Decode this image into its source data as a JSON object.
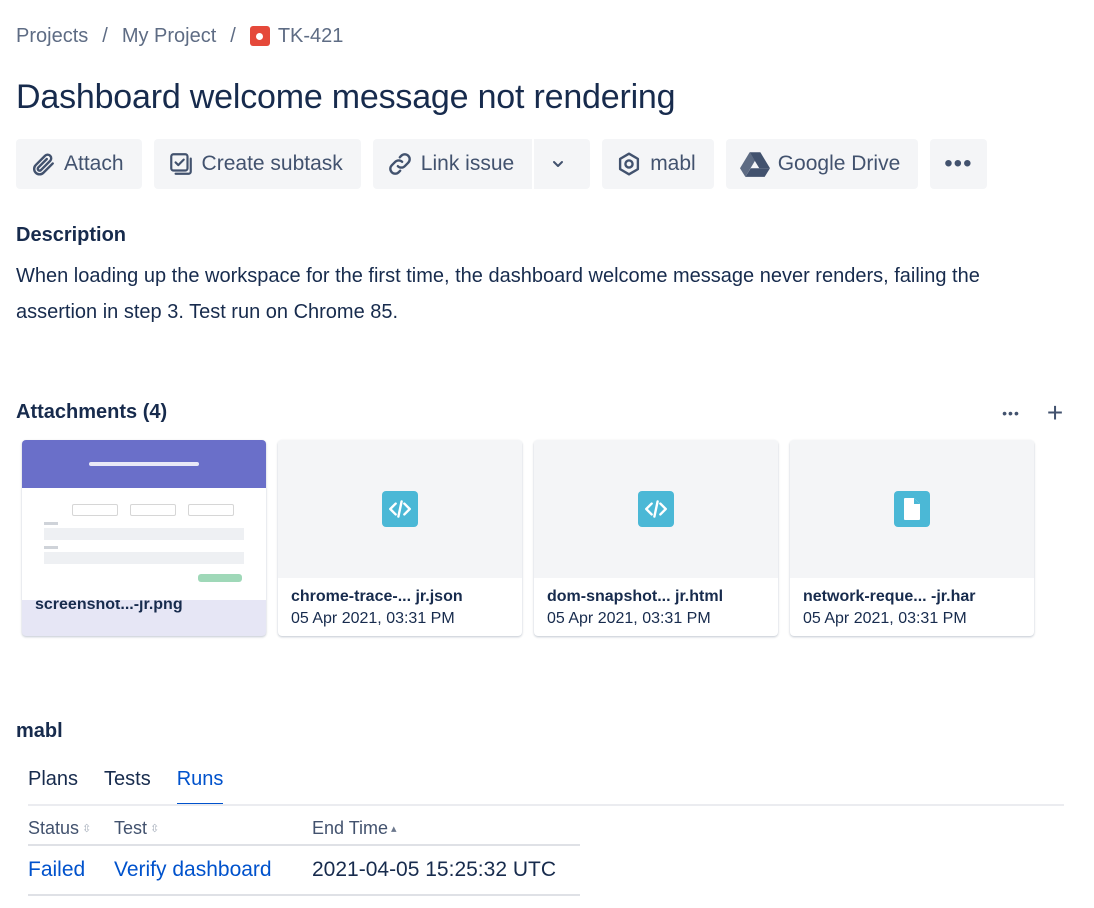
{
  "breadcrumb": {
    "projects": "Projects",
    "separator": "/",
    "project": "My Project",
    "issue_key": "TK-421"
  },
  "issue": {
    "title": "Dashboard welcome message not rendering"
  },
  "toolbar": {
    "attach": "Attach",
    "create_subtask": "Create subtask",
    "link_issue": "Link issue",
    "mabl": "mabl",
    "google_drive": "Google Drive",
    "more": "•••"
  },
  "description": {
    "heading": "Description",
    "text": "When loading up the workspace for the first time, the dashboard welcome message never renders, failing the assertion in step 3. Test run on Chrome 85."
  },
  "attachments": {
    "heading": "Attachments (4)",
    "more": "•••",
    "add": "+",
    "items": [
      {
        "name": "screenshot...-jr.png",
        "date": "",
        "kind": "image"
      },
      {
        "name": "chrome-trace-... jr.json",
        "date": "05 Apr 2021, 03:31 PM",
        "kind": "code"
      },
      {
        "name": "dom-snapshot... jr.html",
        "date": "05 Apr 2021, 03:31 PM",
        "kind": "code"
      },
      {
        "name": "network-reque... -jr.har",
        "date": "05 Apr 2021, 03:31 PM",
        "kind": "document"
      }
    ]
  },
  "mabl": {
    "heading": "mabl",
    "tabs": [
      {
        "label": "Plans",
        "active": false
      },
      {
        "label": "Tests",
        "active": false
      },
      {
        "label": "Runs",
        "active": true
      }
    ],
    "table": {
      "columns": [
        "Status",
        "Test",
        "End Time"
      ],
      "rows": [
        {
          "status": "Failed",
          "test": "Verify dashboard",
          "end_time": "2021-04-05 15:25:32 UTC"
        }
      ]
    }
  },
  "colors": {
    "accent": "#0052cc",
    "bug_icon": "#e5493a",
    "file_icon": "#4bb8d6",
    "button_bg": "#f4f5f7"
  },
  "icons": {
    "attach": "paperclip-icon",
    "create_subtask": "subtask-icon",
    "link_issue": "link-icon",
    "dropdown": "chevron-down-icon",
    "mabl": "mabl-hexagon-icon",
    "google_drive": "google-drive-icon"
  }
}
